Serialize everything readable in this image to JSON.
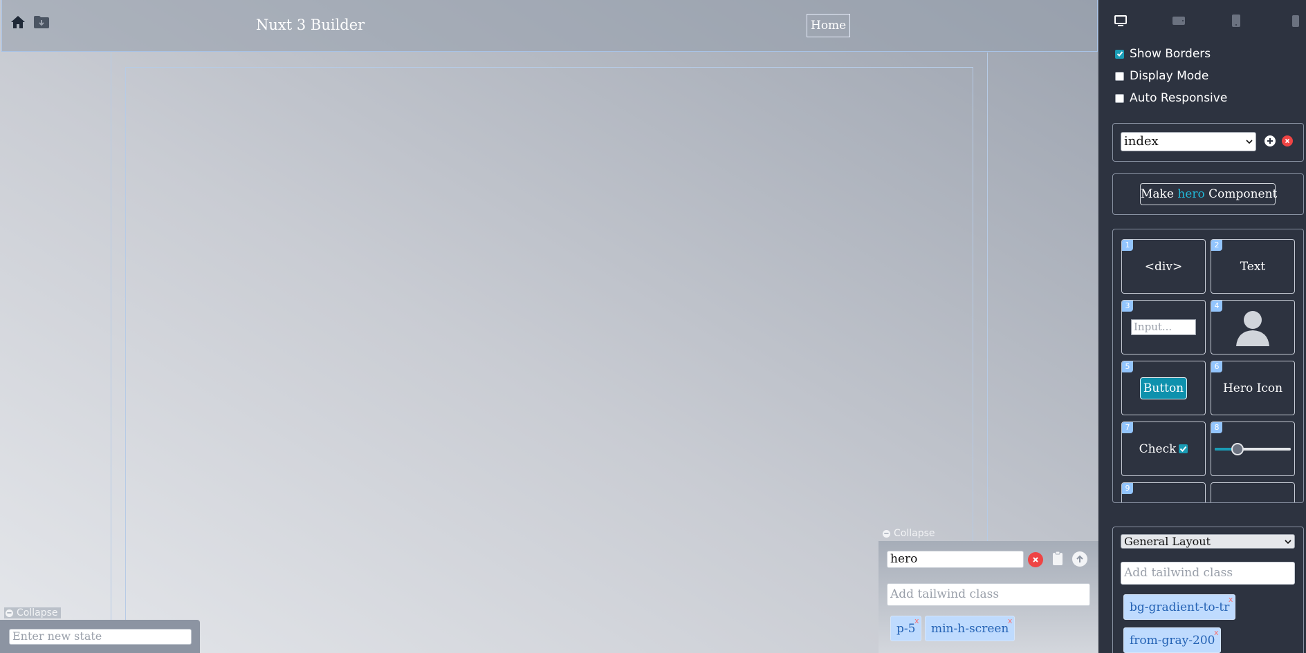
{
  "window": {
    "title": "Nuxt 3 Builder"
  },
  "topbar": {
    "title": "Nuxt 3 Builder",
    "home_link": "Home",
    "icons": [
      "home-icon",
      "folder-download-icon"
    ]
  },
  "state_popup": {
    "collapse_label": "Collapse",
    "input_placeholder": "Enter new state"
  },
  "element_popup": {
    "collapse_label": "Collapse",
    "element_name": "hero",
    "class_placeholder": "Add tailwind class",
    "classes": [
      "p-5",
      "min-h-screen"
    ],
    "chip_remove": "x"
  },
  "sidepanel": {
    "device_icons": [
      "desktop-icon",
      "tablet-landscape-icon",
      "tablet-portrait-icon",
      "mobile-icon"
    ],
    "options": [
      {
        "label": "Show Borders",
        "checked": true
      },
      {
        "label": "Display Mode",
        "checked": false
      },
      {
        "label": "Auto Responsive",
        "checked": false
      }
    ],
    "page_select": {
      "value": "index"
    },
    "make_component": {
      "prefix": "Make",
      "name": "hero",
      "suffix": "Component"
    },
    "palette": [
      {
        "num": "1",
        "label": "<div>"
      },
      {
        "num": "2",
        "label": "Text"
      },
      {
        "num": "3",
        "label": "Input..."
      },
      {
        "num": "4",
        "label": "avatar"
      },
      {
        "num": "5",
        "label": "Button"
      },
      {
        "num": "6",
        "label": "Hero Icon"
      },
      {
        "num": "7",
        "label": "Check"
      },
      {
        "num": "8",
        "label": "slider"
      },
      {
        "num": "9",
        "label": ""
      }
    ],
    "slider_value": 0.3,
    "layout_select": {
      "value": "General Layout"
    },
    "class_placeholder": "Add tailwind class",
    "classes": [
      "bg-gradient-to-tr",
      "from-gray-200"
    ],
    "chip_remove": "x"
  },
  "colors": {
    "accent": "#1a9cb5",
    "panel_bg": "#2d3340",
    "chip_bg": "#bfdbfe",
    "chip_text": "#2563b5",
    "danger": "#ef4444"
  }
}
